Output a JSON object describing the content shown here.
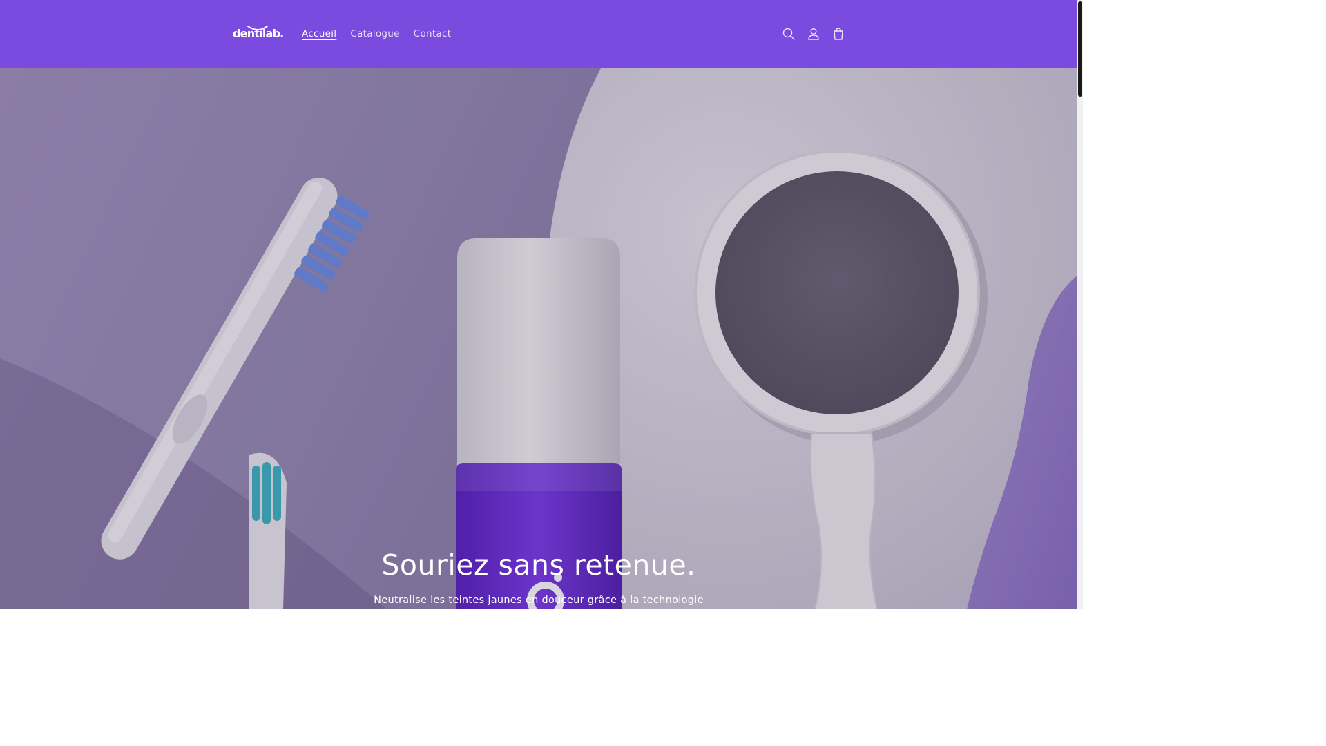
{
  "brand": {
    "logo_text": "dentilab."
  },
  "nav": {
    "items": [
      {
        "label": "Accueil",
        "active": true
      },
      {
        "label": "Catalogue",
        "active": false
      },
      {
        "label": "Contact",
        "active": false
      }
    ]
  },
  "header_icons": [
    "search-icon",
    "account-icon",
    "cart-icon"
  ],
  "hero": {
    "title": "Souriez sans retenue.",
    "subtitle": "Neutralise les teintes jaunes en douceur grâce à la technologie"
  },
  "colors": {
    "header_bg": "#7b4ade",
    "text_on_header": "#ffffff",
    "hero_accent": "#6a2fd6"
  }
}
